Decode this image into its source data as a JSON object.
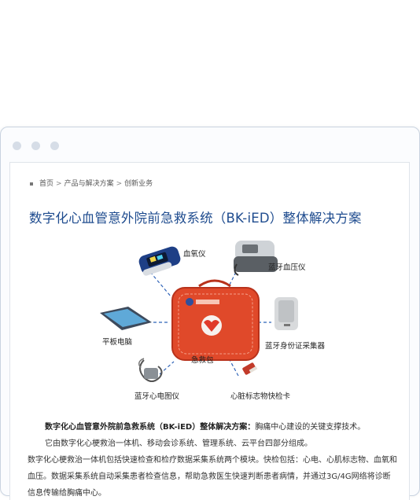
{
  "breadcrumb": {
    "home": "首页",
    "level2": "产品与解决方案",
    "level3": "创新业务",
    "separator": ">"
  },
  "page": {
    "title": "数字化心血管意外院前急救系统（BK-iED）整体解决方案"
  },
  "diagram": {
    "labels": {
      "oximeter": "血氧仪",
      "bp_monitor": "蓝牙血压仪",
      "tablet": "平板电脑",
      "id_reader": "蓝牙身份证采集器",
      "bag": "急救包",
      "ecg": "蓝牙心电图仪",
      "marker_card": "心脏标志物快检卡"
    },
    "bag_text": "急救包",
    "colors": {
      "bag": "#e0492a",
      "bag_dark": "#b8321b",
      "dash_line": "#2f63b8"
    }
  },
  "body": {
    "p1_bold": "数字化心血管意外院前急救系统（BK-iED）整体解决方案：",
    "p1_rest": "胸痛中心建设的关键支撑技术。",
    "p2": "它由数字化心梗救治一体机、移动会诊系统、管理系统、云平台四部分组成。",
    "p3": "数字化心梗救治一体机包括快速检查和检疗数据采集系统两个模块。快检包括：心电、心肌标志物、血氧和血压。数据采集系统自动采集患者检查信息，帮助急救医生快速判断患者病情，并通过3G/4G网络将诊断信息传输给胸痛中心。"
  }
}
